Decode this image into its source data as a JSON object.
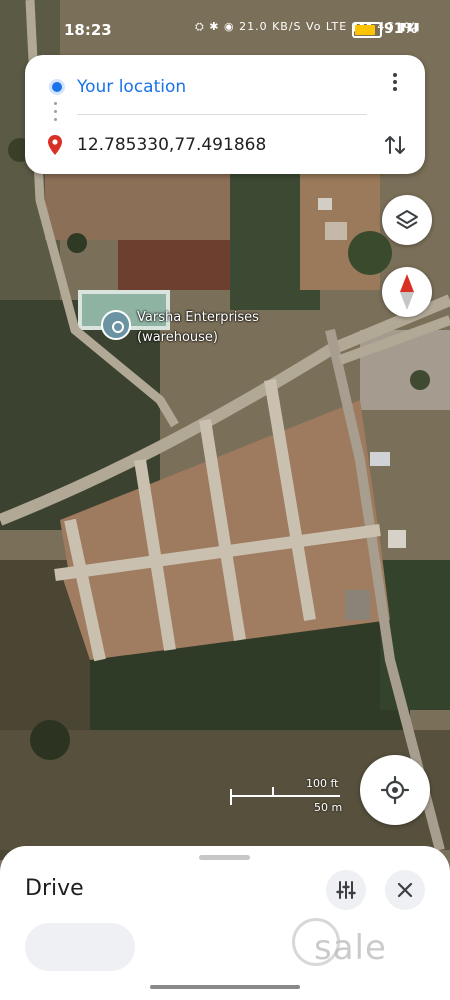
{
  "status_bar": {
    "time": "18:23",
    "icons_text": "⛭ ✱ ◉ 21.0 KB/S Vo LTE ▮▮▮ 4G ▮▮▮",
    "battery_level": 0.91,
    "battery_text": "91%"
  },
  "directions": {
    "origin": "Your location",
    "destination": "12.785330,77.491868"
  },
  "map": {
    "place_name": "Varsha Enterprises (warehouse)",
    "scale_ft": "100 ft",
    "scale_m": "50 m"
  },
  "sheet": {
    "title": "Drive"
  },
  "watermark": {
    "text": "sale"
  },
  "colors": {
    "accent": "#1a73e8",
    "pin": "#d93025",
    "marker": "#6b93a1"
  },
  "icons": {
    "layers": "layers-icon",
    "compass": "compass-icon",
    "locate": "crosshair-icon",
    "swap": "swap-vertical-icon",
    "more": "more-vertical-icon",
    "filter": "tune-icon",
    "close": "close-icon"
  }
}
